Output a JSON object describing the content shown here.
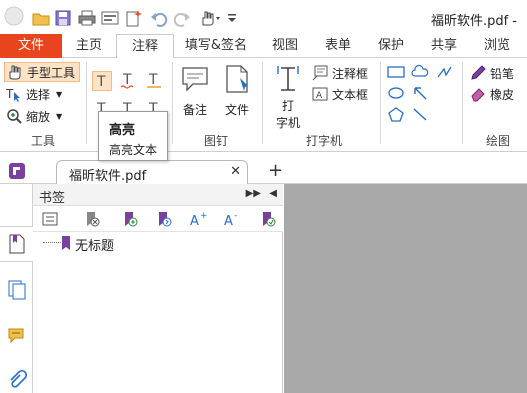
{
  "window": {
    "title": "福昕软件.pdf -"
  },
  "tabs": [
    {
      "label": "文件"
    },
    {
      "label": "主页"
    },
    {
      "label": "注释"
    },
    {
      "label": "填写&签名"
    },
    {
      "label": "视图"
    },
    {
      "label": "表单"
    },
    {
      "label": "保护"
    },
    {
      "label": "共享"
    },
    {
      "label": "浏览"
    }
  ],
  "ribbon": {
    "tools": {
      "hand": "手型工具",
      "select": "选择",
      "zoom": "缩放",
      "group": "工具"
    },
    "pin": {
      "note": "备注",
      "file": "文件",
      "group": "图钉"
    },
    "typewriter": {
      "type_line1": "打",
      "type_line2": "字机",
      "annotation_box": "注释框",
      "text_box": "文本框",
      "group": "打字机"
    },
    "draw": {
      "pencil": "铅笔",
      "eraser": "橡皮",
      "group": "绘图"
    }
  },
  "tooltip": {
    "title": "高亮",
    "description": "高亮文本"
  },
  "document": {
    "tab_name": "福昕软件.pdf",
    "new_tab": "+"
  },
  "bookmarks": {
    "panel_title": "书签",
    "items": [
      {
        "label": "无标题"
      }
    ]
  },
  "colors": {
    "file_tab": "#e8451e",
    "bookmark_accent": "#7b3fa0",
    "document_bg": "#a9a9a9",
    "highlight_tool": "#fde2c6"
  }
}
